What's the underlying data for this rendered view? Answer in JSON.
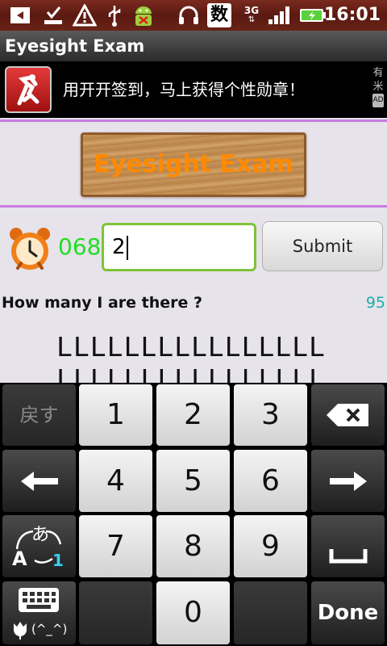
{
  "status_bar": {
    "time": "16:01",
    "network": "3G",
    "ime_char": "数",
    "icons": [
      "ime-icon",
      "download-icon",
      "warning-icon",
      "usb-icon",
      "android-icon",
      "headset-icon",
      "ime-char-icon",
      "network-3g-icon",
      "signal-icon",
      "battery-icon"
    ]
  },
  "title": "Eyesight Exam",
  "ad": {
    "text": "用开开签到，马上获得个性勋章！",
    "mark": [
      "有",
      "米",
      "AD"
    ]
  },
  "header": {
    "logo_title": "Eyesight Exam"
  },
  "quiz": {
    "counter": "068",
    "answer_value": "2",
    "submit_label": "Submit",
    "question": "How many I are there ?",
    "score": "95",
    "letter_rows": [
      "LLLLLLLLLLLLLLLL",
      "LLLLLLLLLLLLLLLL"
    ]
  },
  "keyboard": {
    "keys": {
      "modifier": "戻す",
      "k1": "1",
      "k2": "2",
      "k3": "3",
      "k4": "4",
      "k5": "5",
      "k6": "6",
      "k7": "7",
      "k8": "8",
      "k9": "9",
      "k0": "0",
      "done": "Done",
      "mode_hiragana": "あ",
      "mode_latin": "A",
      "mode_num": "1",
      "emoticon": "(^_^)"
    }
  },
  "colors": {
    "accent_purple": "#c87ce0",
    "counter_green": "#22dd22",
    "score_teal": "#22aaaa",
    "title_orange": "#ff8a00",
    "input_border": "#7fc23a"
  }
}
